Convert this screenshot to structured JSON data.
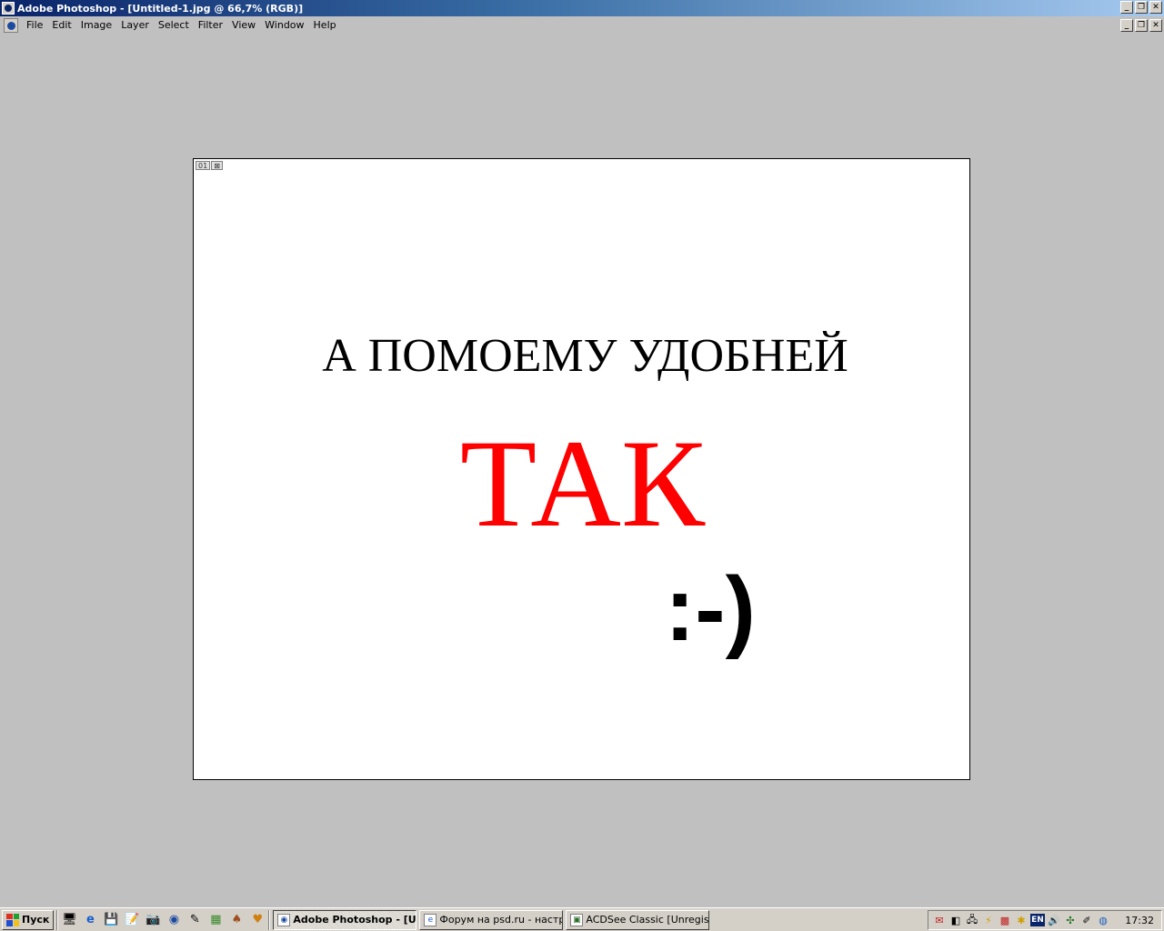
{
  "window": {
    "title": "Adobe Photoshop - [Untitled-1.jpg @ 66,7% (RGB)]",
    "buttons": {
      "minimize": "_",
      "restore": "❐",
      "close": "✕"
    }
  },
  "menubar": {
    "items": [
      "File",
      "Edit",
      "Image",
      "Layer",
      "Select",
      "Filter",
      "View",
      "Window",
      "Help"
    ]
  },
  "canvas": {
    "layer_tags": [
      "01",
      "⊠"
    ],
    "line1": "А ПОМОЕМУ УДОБНЕЙ",
    "line2": "ТАК",
    "smiley": ":-)",
    "colors": {
      "line1": "#000000",
      "line2": "#ff0000",
      "background": "#ffffff"
    }
  },
  "taskbar": {
    "start_label": "Пуск",
    "quick_launch_icons": [
      "show-desktop-icon",
      "ie-icon",
      "save-icon",
      "notepad-icon",
      "camera-icon",
      "photoshop-icon",
      "pencil-icon",
      "paint-icon",
      "pin-icon",
      "winamp-icon"
    ],
    "tasks": [
      {
        "label": "Adobe Photoshop - [U...",
        "active": true
      },
      {
        "label": "Форум на psd.ru - настр...",
        "active": false
      },
      {
        "label": "ACDSee Classic [Unregist...",
        "active": false
      }
    ],
    "tray": {
      "language": "EN",
      "clock": "17:32"
    }
  }
}
